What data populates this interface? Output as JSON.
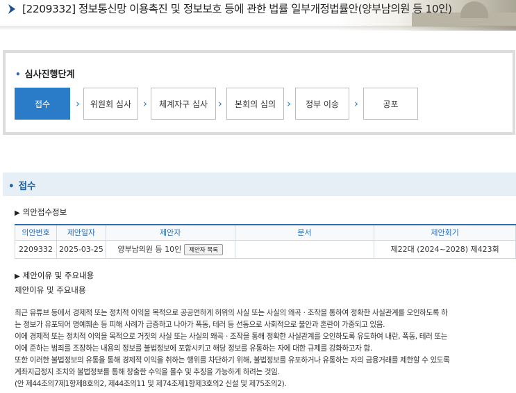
{
  "page": {
    "title": "[2209332] 정보통신망 이용촉진 및 정보보호 등에 관한 법률 일부개정법률안(양부남의원 등 10인)"
  },
  "stage": {
    "heading": "심사진행단계",
    "steps": [
      {
        "label": "접수",
        "active": true
      },
      {
        "label": "위원회 심사",
        "active": false
      },
      {
        "label": "체계자구 심사",
        "active": false
      },
      {
        "label": "본회의 심의",
        "active": false
      },
      {
        "label": "정부 이송",
        "active": false
      },
      {
        "label": "공포",
        "active": false
      }
    ]
  },
  "reception": {
    "heading": "접수",
    "info_heading": "의안접수정보",
    "table": {
      "headers": [
        "의안번호",
        "제안일자",
        "제안자",
        "문서",
        "제안회기"
      ],
      "row": {
        "bill_no": "2209332",
        "date": "2025-03-25",
        "proposer": "양부남의원 등 10인",
        "proposer_button": "제안자 목록",
        "document": "",
        "session": "제22대 (2024~2028) 제423회"
      }
    },
    "reason_heading": "제안이유 및 주요내용",
    "reason_label": "제안이유 및 주요내용",
    "paragraphs": [
      "최근 유튜브 등에서 경제적 또는 정치적 이익을 목적으로 공공연하게 허위의 사실 또는 사실의 왜곡ㆍ조작을 통하여 정확한 사실관계를 오인하도록 하",
      "는 정보가 유포되어 명예훼손 등 피해 사례가 급증하고 나아가 폭동, 테러 등 선동으로 사회적으로 불안과 혼란이 가중되고 있음.",
      "이에 경제적 또는 정치적 이익을 목적으로 거짓의 사실 또는 사실의 왜곡ㆍ조작을 통해 정확한 사실관계를 오인하도록 유도하여 내란, 폭동, 테러 또는",
      "이에 준하는 범죄를 조장하는 내용의 정보를 불법정보에 포함시키고 해당 정보를 유통하는 자에 대한 규제를 강화하고자 함.",
      "또한 이러한 불법정보의 유통을 통해 경제적 이익을 취하는 행위를 차단하기 위해, 불법정보를 유포하거나 유통하는 자의 금융거래를 제한할 수 있도록",
      "계좌지급정지 조치와 불법정보를 통해 창출한 수익을 몰수 및 추징을 가능하게 하려는 것임.",
      "(안 제44조의7제1항제8호의2, 제44조의11 및 제74조제1항제3호의2 신설 및 제75조의2)."
    ]
  },
  "colors": {
    "accent": "#2a7bc8",
    "section_bg": "#e6eef6"
  },
  "icons": {
    "title_arrow": "chevron-right-icon",
    "step_separator": "chevron-right-icon"
  }
}
